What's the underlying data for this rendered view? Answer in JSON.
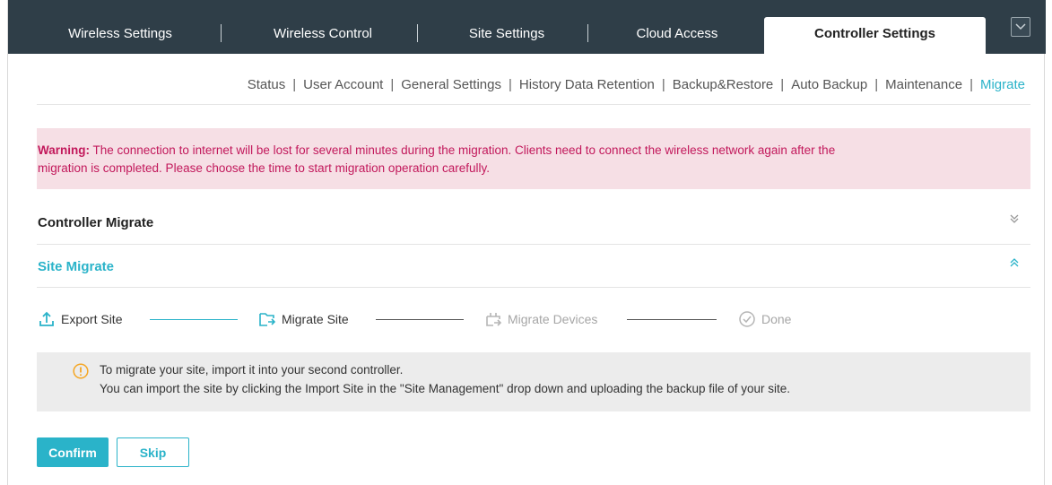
{
  "top_tabs": [
    {
      "label": "Wireless Settings",
      "active": false
    },
    {
      "label": "Wireless Control",
      "active": false
    },
    {
      "label": "Site Settings",
      "active": false
    },
    {
      "label": "Cloud Access",
      "active": false
    },
    {
      "label": "Controller Settings",
      "active": true
    }
  ],
  "sub_nav": [
    {
      "label": "Status",
      "active": false
    },
    {
      "label": "User Account",
      "active": false
    },
    {
      "label": "General Settings",
      "active": false
    },
    {
      "label": "History Data Retention",
      "active": false
    },
    {
      "label": "Backup&Restore",
      "active": false
    },
    {
      "label": "Auto Backup",
      "active": false
    },
    {
      "label": "Maintenance",
      "active": false
    },
    {
      "label": "Migrate",
      "active": true
    }
  ],
  "warning": {
    "label": "Warning:",
    "text_line1": " The connection to internet will be lost for several minutes during the migration. Clients need to connect the wireless network again after the",
    "text_line2": "migration is completed. Please choose the time to start migration operation carefully."
  },
  "sections": {
    "controller_migrate": {
      "title": "Controller Migrate",
      "expanded": false
    },
    "site_migrate": {
      "title": "Site Migrate",
      "expanded": true
    }
  },
  "steps": [
    {
      "label": "Export Site",
      "icon": "export-icon",
      "state": "completed"
    },
    {
      "label": "Migrate Site",
      "icon": "migrate-site-icon",
      "state": "current"
    },
    {
      "label": "Migrate Devices",
      "icon": "migrate-devices-icon",
      "state": "pending"
    },
    {
      "label": "Done",
      "icon": "check-circle-icon",
      "state": "pending"
    }
  ],
  "info": {
    "line1": "To migrate your site, import it into your second controller.",
    "line2": "You can import the site by clicking the Import Site in the \"Site Management\" drop down and uploading the backup file of your site."
  },
  "buttons": {
    "confirm": "Confirm",
    "skip": "Skip"
  },
  "colors": {
    "accent": "#2ab3c9",
    "topbar": "#2f3e48",
    "warning_bg": "#f6dfe5",
    "warning_text": "#c2185b",
    "info_bg": "#ececec",
    "info_icon": "#f5a623"
  }
}
